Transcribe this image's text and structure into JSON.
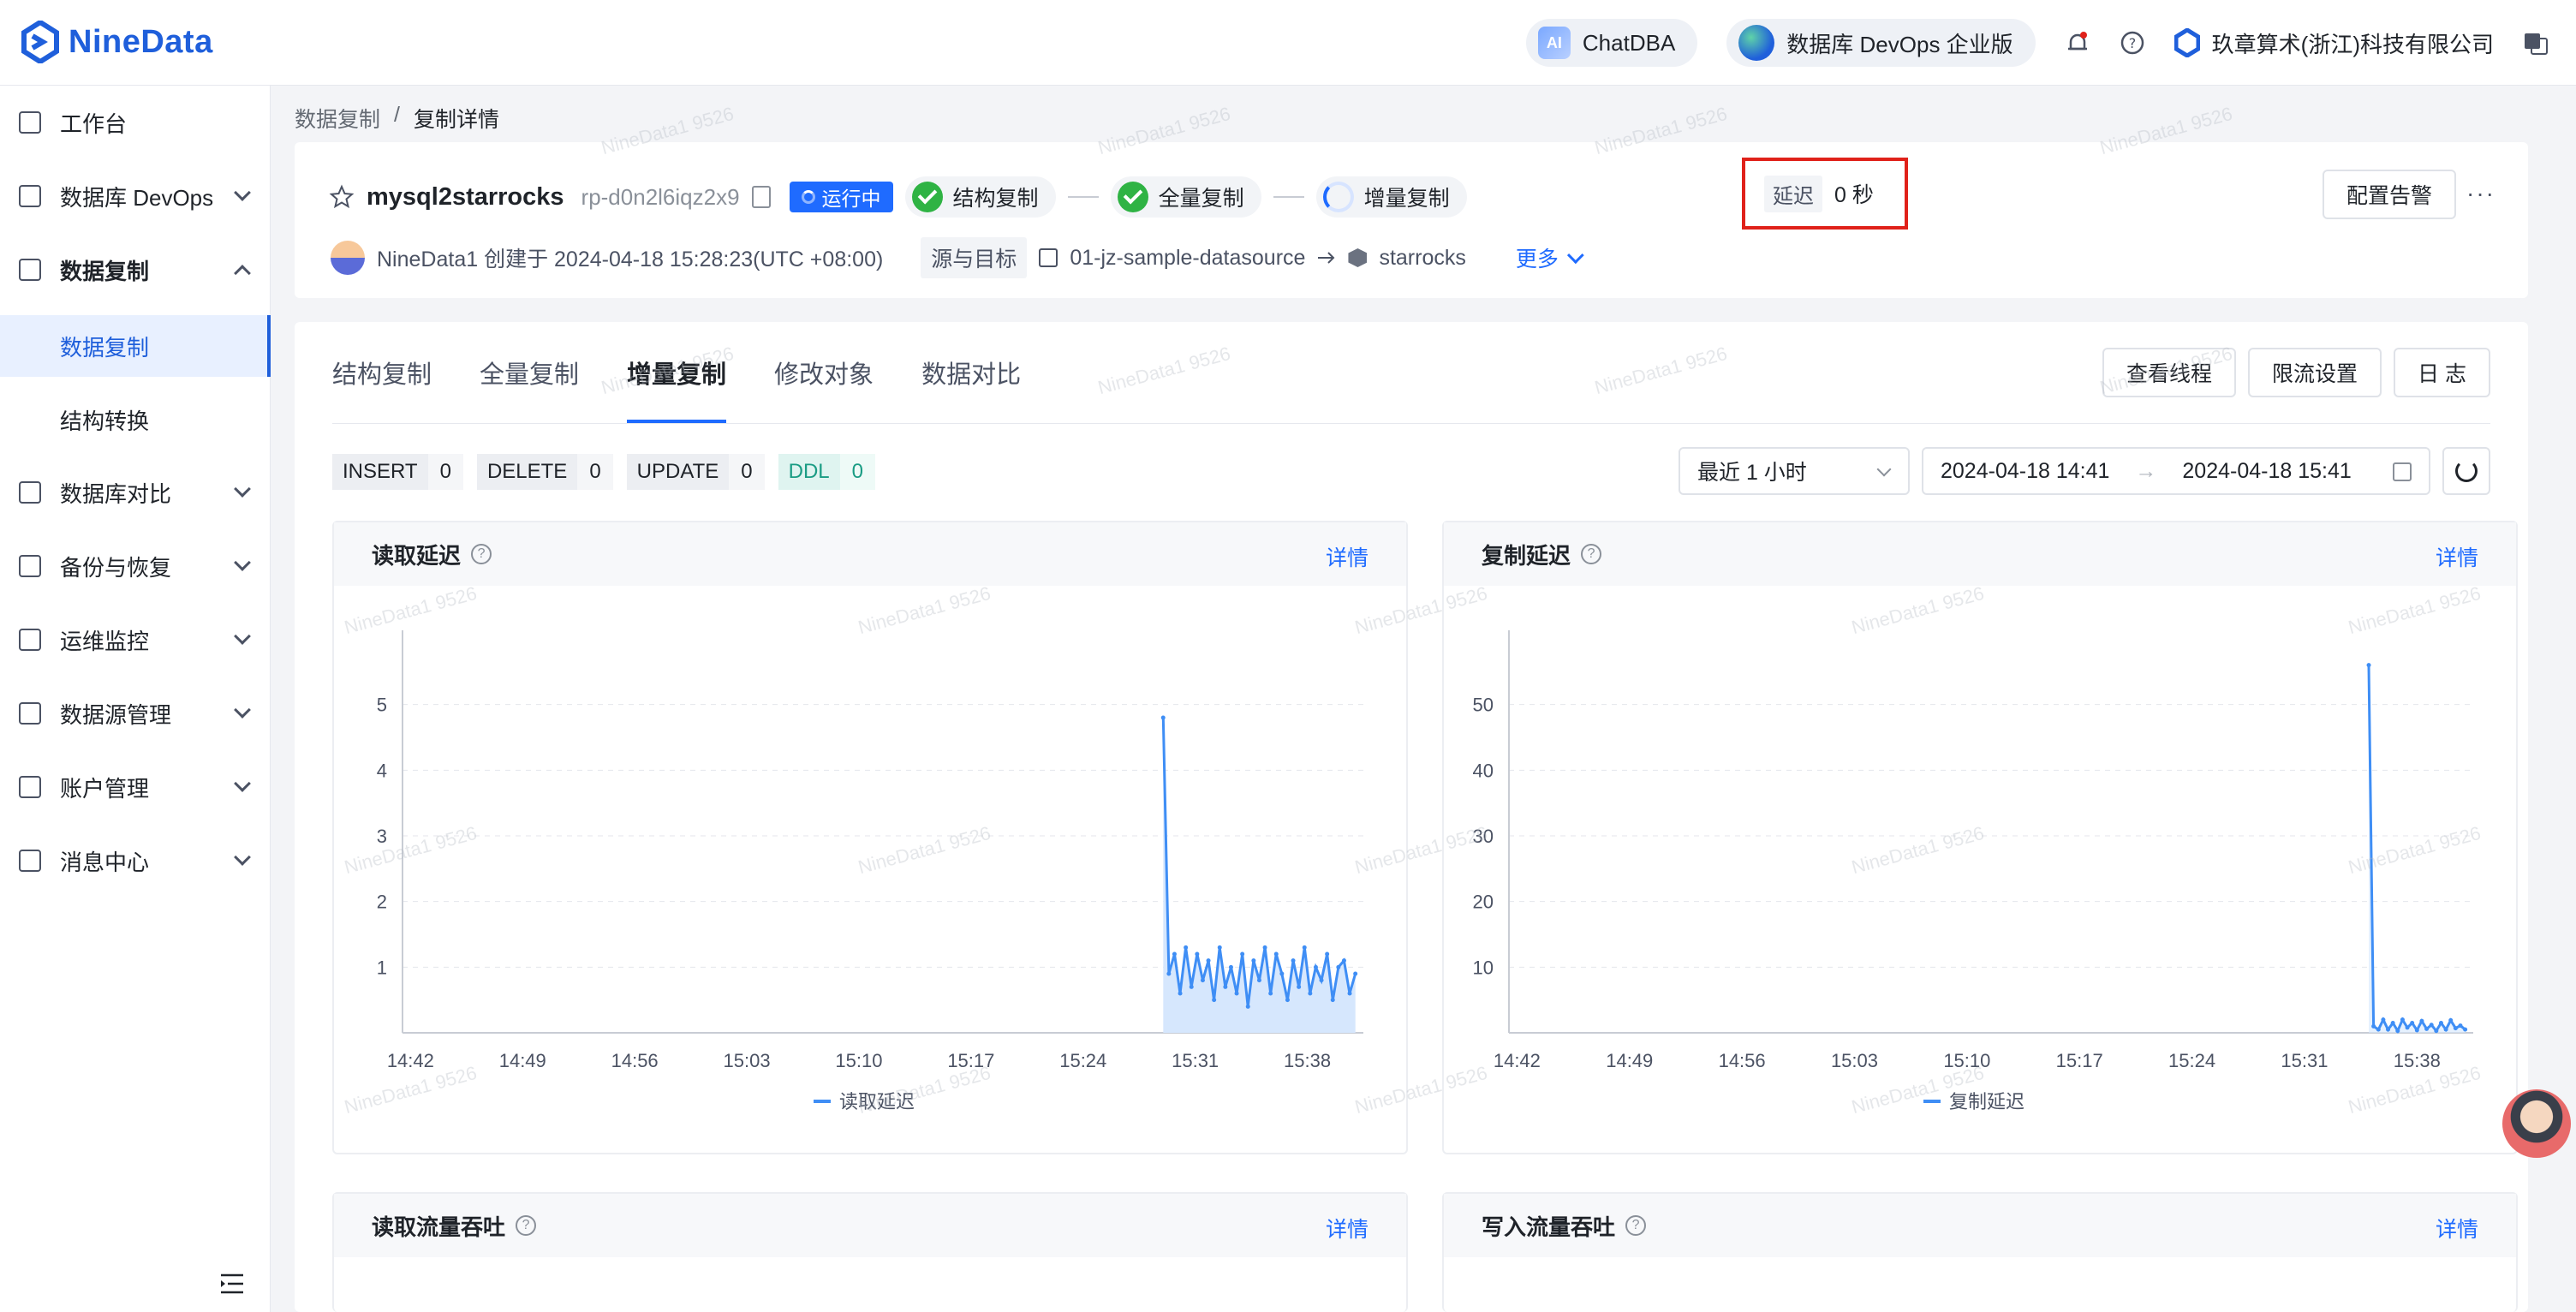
{
  "app": {
    "brand": "NineData"
  },
  "topbar": {
    "chatdba": "ChatDBA",
    "chatdba_icon": "AI",
    "edition": "数据库 DevOps 企业版",
    "company": "玖章算术(浙江)科技有限公司"
  },
  "sidebar": {
    "items": [
      {
        "label": "工作台",
        "icon": "home-icon"
      },
      {
        "label": "数据库 DevOps",
        "icon": "devops-icon"
      },
      {
        "label": "数据复制",
        "icon": "replication-icon"
      },
      {
        "label": "数据库对比",
        "icon": "compare-icon"
      },
      {
        "label": "备份与恢复",
        "icon": "backup-icon"
      },
      {
        "label": "运维监控",
        "icon": "monitor-icon"
      },
      {
        "label": "数据源管理",
        "icon": "datasource-icon"
      },
      {
        "label": "账户管理",
        "icon": "account-icon"
      },
      {
        "label": "消息中心",
        "icon": "message-icon"
      }
    ],
    "sub_items": [
      {
        "label": "数据复制",
        "active": true
      },
      {
        "label": "结构转换",
        "active": false
      }
    ]
  },
  "breadcrumb": {
    "parent": "数据复制",
    "separator": "/",
    "current": "复制详情"
  },
  "task": {
    "name": "mysql2starrocks",
    "id": "rp-d0n2l6iqz2x9",
    "status": "运行中",
    "stages": [
      "结构复制",
      "全量复制",
      "增量复制"
    ],
    "delay_label": "延迟",
    "delay_value": "0 秒",
    "alert_button": "配置告警",
    "more_dots": "···",
    "creator_text": "NineData1 创建于 2024-04-18 15:28:23(UTC +08:00)",
    "source_target_label": "源与目标",
    "source": "01-jz-sample-datasource",
    "target": "starrocks",
    "more_link": "更多"
  },
  "tabs": [
    "结构复制",
    "全量复制",
    "增量复制",
    "修改对象",
    "数据对比"
  ],
  "active_tab": "增量复制",
  "tab_actions": [
    "查看线程",
    "限流设置",
    "日 志"
  ],
  "stats": [
    {
      "key": "INSERT",
      "value": "0"
    },
    {
      "key": "DELETE",
      "value": "0"
    },
    {
      "key": "UPDATE",
      "value": "0"
    },
    {
      "key": "DDL",
      "value": "0"
    }
  ],
  "time_filter": {
    "preset": "最近 1 小时",
    "start": "2024-04-18 14:41",
    "arrow": "→",
    "end": "2024-04-18 15:41"
  },
  "cards": {
    "read_latency": {
      "title": "读取延迟",
      "detail": "详情"
    },
    "replication_latency": {
      "title": "复制延迟",
      "detail": "详情"
    },
    "read_throughput": {
      "title": "读取流量吞吐",
      "detail": "详情"
    },
    "write_throughput": {
      "title": "写入流量吞吐",
      "detail": "详情"
    }
  },
  "colors": {
    "accent": "#1f6bff",
    "line": "#3f8ef5",
    "area": "#d6e7fd",
    "highlight_box": "#e0211a"
  },
  "watermark": "NineData1 9526",
  "chart_data": [
    {
      "type": "area",
      "title": "读取延迟",
      "legend": "top-none-bottom",
      "series": [
        {
          "name": "读取延迟",
          "values": [
            4.8,
            0.9,
            1.2,
            0.6,
            1.3,
            0.7,
            1.2,
            0.8,
            1.1,
            0.5,
            1.3,
            0.7,
            1.0,
            0.6,
            1.2,
            0.4,
            1.1,
            0.8,
            1.3,
            0.6,
            1.2,
            0.9,
            0.5,
            1.1,
            0.7,
            1.3,
            0.6,
            1.0,
            0.8,
            1.2,
            0.5,
            1.0,
            1.1,
            0.6,
            0.9
          ]
        }
      ],
      "x_ticks": [
        "14:42",
        "14:49",
        "14:56",
        "15:03",
        "15:10",
        "15:17",
        "15:24",
        "15:31",
        "15:38"
      ],
      "x_start": "15:29",
      "x_end": "15:41",
      "y_ticks": [
        1,
        2,
        3,
        4,
        5
      ],
      "ylim": [
        0,
        6
      ]
    },
    {
      "type": "area",
      "title": "复制延迟",
      "legend": "bottom",
      "series": [
        {
          "name": "复制延迟",
          "values": [
            56,
            1,
            0.5,
            2,
            0.5,
            1.5,
            0.3,
            2,
            0.8,
            1.5,
            0.4,
            1.8,
            0.6,
            1.2,
            0.3,
            1.5,
            0.5,
            1.9,
            0.7,
            1.1,
            0.5
          ]
        }
      ],
      "x_ticks": [
        "14:42",
        "14:49",
        "14:56",
        "15:03",
        "15:10",
        "15:17",
        "15:24",
        "15:31",
        "15:38"
      ],
      "x_start": "15:35",
      "x_end": "15:41",
      "y_ticks": [
        10,
        20,
        30,
        40,
        50
      ],
      "ylim": [
        0,
        60
      ]
    }
  ]
}
